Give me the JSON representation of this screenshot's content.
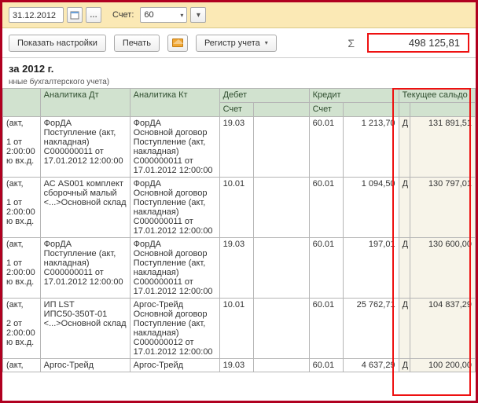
{
  "toolbar": {
    "date": "31.12.2012",
    "account_label": "Счет:",
    "account_value": "60",
    "show_settings": "Показать настройки",
    "print": "Печать",
    "register": "Регистр учета",
    "total": "498 125,81"
  },
  "title": "за 2012 г.",
  "subtitle": "нные бухгалтерского учета)",
  "headers": {
    "an_dt": "Аналитика Дт",
    "an_kt": "Аналитика Кт",
    "debit": "Дебет",
    "credit": "Кредит",
    "balance": "Текущее сальдо",
    "schet": "Счет"
  },
  "rows": [
    {
      "left": "(акт,\n\n1 от\n2:00:00\nю вх.д.",
      "an_dt": "ФорДА\nПоступление (акт, накладная) С000000011 от 17.01.2012 12:00:00",
      "an_kt": "ФорДА\nОсновной договор\nПоступление (акт, накладная)\nС000000011 от 17.01.2012 12:00:00",
      "schet1": "19.03",
      "debit": "",
      "schet2": "60.01",
      "credit": "1 213,70",
      "dc": "Д",
      "balance": "131 891,51"
    },
    {
      "left": "(акт,\n\n1 от\n2:00:00\nю вх.д.",
      "an_dt": "АС AS001 комплект сборочный малый\n<...>Основной склад",
      "an_kt": "ФорДА\nОсновной договор\nПоступление (акт, накладная)\nС000000011 от 17.01.2012 12:00:00",
      "schet1": "10.01",
      "debit": "",
      "schet2": "60.01",
      "credit": "1 094,50",
      "dc": "Д",
      "balance": "130 797,01"
    },
    {
      "left": "(акт,\n\n1 от\n2:00:00\nю вх.д.",
      "an_dt": "ФорДА\nПоступление (акт, накладная) С000000011 от 17.01.2012 12:00:00",
      "an_kt": "ФорДА\nОсновной договор\nПоступление (акт, накладная)\nС000000011 от 17.01.2012 12:00:00",
      "schet1": "19.03",
      "debit": "",
      "schet2": "60.01",
      "credit": "197,01",
      "dc": "Д",
      "balance": "130 600,00"
    },
    {
      "left": "(акт,\n\n2 от\n2:00:00\nю вх.д.",
      "an_dt": "ИП LST\nИПС50-350Т-01\n<...>Основной склад",
      "an_kt": "Аргос-Трейд\nОсновной договор\nПоступление (акт, накладная)\nС000000012 от 17.01.2012 12:00:00",
      "schet1": "10.01",
      "debit": "",
      "schet2": "60.01",
      "credit": "25 762,71",
      "dc": "Д",
      "balance": "104 837,29"
    },
    {
      "left": "(акт,",
      "an_dt": "Аргос-Трейд",
      "an_kt": "Аргос-Трейд",
      "schet1": "19.03",
      "debit": "",
      "schet2": "60.01",
      "credit": "4 637,29",
      "dc": "Д",
      "balance": "100 200,00"
    }
  ]
}
